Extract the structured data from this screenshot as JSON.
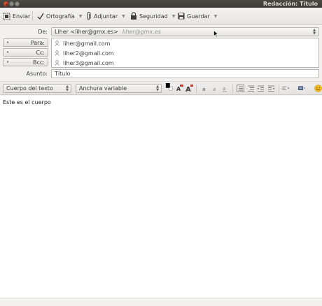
{
  "window": {
    "title": "Redacción: Título"
  },
  "toolbar": {
    "send_label": "Enviar",
    "spelling_label": "Ortografía",
    "attach_label": "Adjuntar",
    "security_label": "Seguridad",
    "save_label": "Guardar"
  },
  "header": {
    "from_label": "De:",
    "from_value": "Liher <liher@gmx.es>",
    "from_hint": "liher@gmx.es",
    "recipients": [
      {
        "type": "Para:",
        "address": "liher@gmail.com"
      },
      {
        "type": "Cc:",
        "address": "liher2@gmail.com"
      },
      {
        "type": "Bcc:",
        "address": "liher3@gmail.com"
      }
    ],
    "subject_label": "Asunto:",
    "subject_value": "Título"
  },
  "format": {
    "paragraph_style": "Cuerpo del texto",
    "font": "Anchura variable"
  },
  "body": {
    "text": "Este es el cuerpo"
  },
  "colors": {
    "titlebar": "#3c3b37",
    "close_button": "#e2572c",
    "editor_bg": "#ffffff"
  },
  "icons": [
    "close-icon",
    "minimize-icon",
    "maximize-icon",
    "send-icon",
    "spellcheck-icon",
    "paperclip-icon",
    "lock-icon",
    "floppy-icon",
    "contact-icon",
    "text-color-icon",
    "font-smaller-icon",
    "font-larger-icon",
    "bold-icon",
    "italic-icon",
    "underline-icon",
    "bullet-list-icon",
    "numbered-list-icon",
    "outdent-icon",
    "indent-icon",
    "align-icon",
    "insert-icon",
    "smiley-icon"
  ]
}
